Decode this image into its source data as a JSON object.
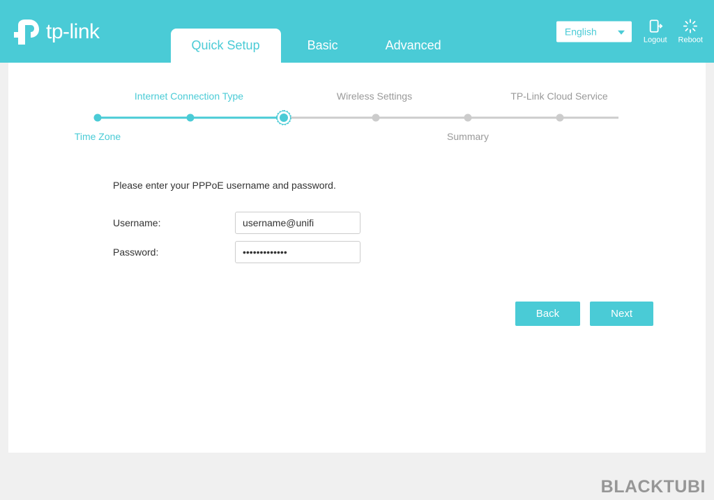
{
  "brand": "tp-link",
  "tabs": {
    "quick_setup": "Quick Setup",
    "basic": "Basic",
    "advanced": "Advanced"
  },
  "header": {
    "language": "English",
    "logout": "Logout",
    "reboot": "Reboot"
  },
  "stepper": {
    "time_zone": "Time Zone",
    "internet_connection_type": "Internet Connection Type",
    "wireless_settings": "Wireless Settings",
    "summary": "Summary",
    "tp_link_cloud": "TP-Link Cloud Service"
  },
  "form": {
    "instruction": "Please enter your PPPoE username and password.",
    "username_label": "Username:",
    "username_value": "username@unifi",
    "password_label": "Password:",
    "password_value": "•••••••••••••"
  },
  "buttons": {
    "back": "Back",
    "next": "Next"
  },
  "watermark": "BLACKTUBI"
}
